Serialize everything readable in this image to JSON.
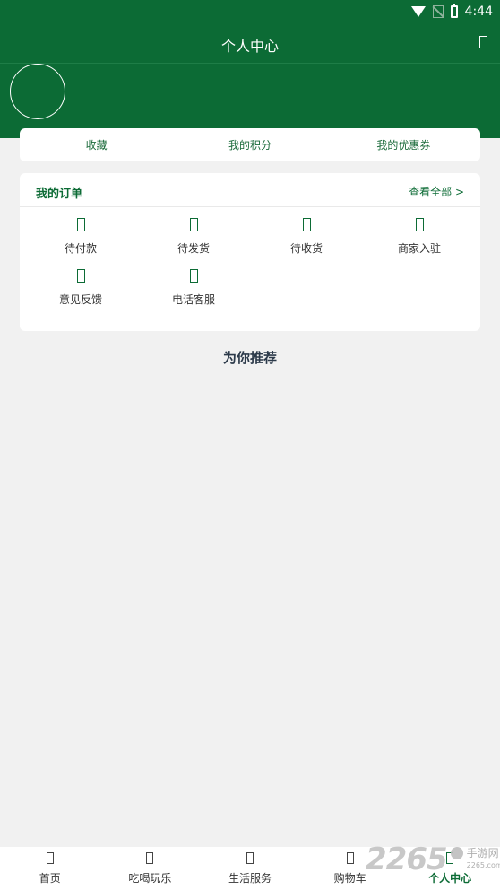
{
  "status_bar": {
    "time": "4:44"
  },
  "header": {
    "title": "个人中心"
  },
  "quick_links": [
    {
      "label": "收藏"
    },
    {
      "label": "我的积分"
    },
    {
      "label": "我的优惠券"
    }
  ],
  "orders": {
    "title": "我的订单",
    "view_all": "查看全部 >",
    "items": [
      {
        "label": "待付款",
        "icon": "payment-icon"
      },
      {
        "label": "待发货",
        "icon": "shipping-icon"
      },
      {
        "label": "待收货",
        "icon": "receive-icon"
      },
      {
        "label": "商家入驻",
        "icon": "merchant-icon"
      },
      {
        "label": "意见反馈",
        "icon": "feedback-icon"
      },
      {
        "label": "电话客服",
        "icon": "phone-icon"
      }
    ]
  },
  "recommend": {
    "title": "为你推荐"
  },
  "tabbar": {
    "items": [
      {
        "label": "首页",
        "active": false
      },
      {
        "label": "吃喝玩乐",
        "active": false
      },
      {
        "label": "生活服务",
        "active": false
      },
      {
        "label": "购物车",
        "active": false
      },
      {
        "label": "个人中心",
        "active": true
      }
    ]
  },
  "watermark": {
    "number": "2265",
    "site": "手游网",
    "domain": "2265.com"
  },
  "colors": {
    "primary": "#0c6b35",
    "background": "#f1f1f1",
    "card": "#ffffff"
  }
}
